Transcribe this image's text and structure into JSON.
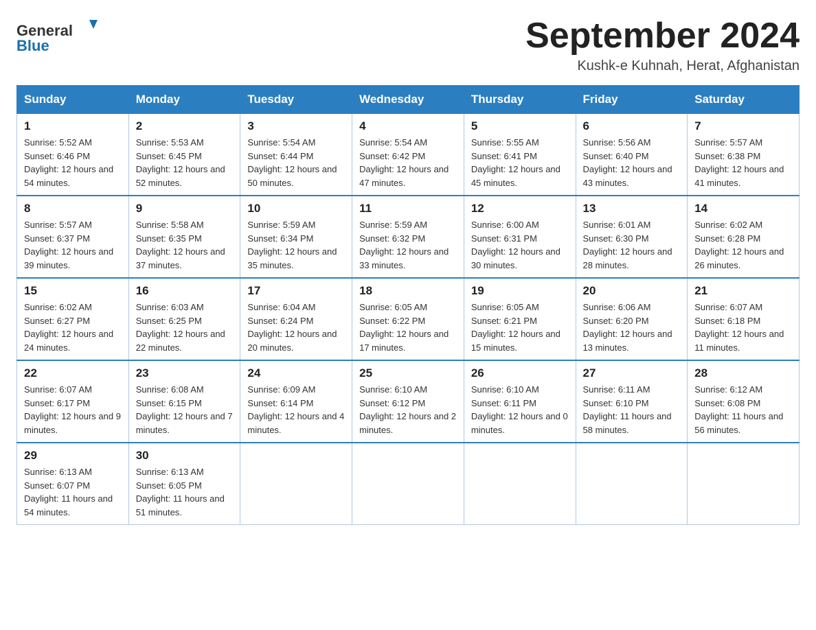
{
  "header": {
    "logo_general": "General",
    "logo_blue": "Blue",
    "title": "September 2024",
    "location": "Kushk-e Kuhnah, Herat, Afghanistan"
  },
  "days_of_week": [
    "Sunday",
    "Monday",
    "Tuesday",
    "Wednesday",
    "Thursday",
    "Friday",
    "Saturday"
  ],
  "weeks": [
    [
      {
        "day": "1",
        "sunrise": "Sunrise: 5:52 AM",
        "sunset": "Sunset: 6:46 PM",
        "daylight": "Daylight: 12 hours and 54 minutes."
      },
      {
        "day": "2",
        "sunrise": "Sunrise: 5:53 AM",
        "sunset": "Sunset: 6:45 PM",
        "daylight": "Daylight: 12 hours and 52 minutes."
      },
      {
        "day": "3",
        "sunrise": "Sunrise: 5:54 AM",
        "sunset": "Sunset: 6:44 PM",
        "daylight": "Daylight: 12 hours and 50 minutes."
      },
      {
        "day": "4",
        "sunrise": "Sunrise: 5:54 AM",
        "sunset": "Sunset: 6:42 PM",
        "daylight": "Daylight: 12 hours and 47 minutes."
      },
      {
        "day": "5",
        "sunrise": "Sunrise: 5:55 AM",
        "sunset": "Sunset: 6:41 PM",
        "daylight": "Daylight: 12 hours and 45 minutes."
      },
      {
        "day": "6",
        "sunrise": "Sunrise: 5:56 AM",
        "sunset": "Sunset: 6:40 PM",
        "daylight": "Daylight: 12 hours and 43 minutes."
      },
      {
        "day": "7",
        "sunrise": "Sunrise: 5:57 AM",
        "sunset": "Sunset: 6:38 PM",
        "daylight": "Daylight: 12 hours and 41 minutes."
      }
    ],
    [
      {
        "day": "8",
        "sunrise": "Sunrise: 5:57 AM",
        "sunset": "Sunset: 6:37 PM",
        "daylight": "Daylight: 12 hours and 39 minutes."
      },
      {
        "day": "9",
        "sunrise": "Sunrise: 5:58 AM",
        "sunset": "Sunset: 6:35 PM",
        "daylight": "Daylight: 12 hours and 37 minutes."
      },
      {
        "day": "10",
        "sunrise": "Sunrise: 5:59 AM",
        "sunset": "Sunset: 6:34 PM",
        "daylight": "Daylight: 12 hours and 35 minutes."
      },
      {
        "day": "11",
        "sunrise": "Sunrise: 5:59 AM",
        "sunset": "Sunset: 6:32 PM",
        "daylight": "Daylight: 12 hours and 33 minutes."
      },
      {
        "day": "12",
        "sunrise": "Sunrise: 6:00 AM",
        "sunset": "Sunset: 6:31 PM",
        "daylight": "Daylight: 12 hours and 30 minutes."
      },
      {
        "day": "13",
        "sunrise": "Sunrise: 6:01 AM",
        "sunset": "Sunset: 6:30 PM",
        "daylight": "Daylight: 12 hours and 28 minutes."
      },
      {
        "day": "14",
        "sunrise": "Sunrise: 6:02 AM",
        "sunset": "Sunset: 6:28 PM",
        "daylight": "Daylight: 12 hours and 26 minutes."
      }
    ],
    [
      {
        "day": "15",
        "sunrise": "Sunrise: 6:02 AM",
        "sunset": "Sunset: 6:27 PM",
        "daylight": "Daylight: 12 hours and 24 minutes."
      },
      {
        "day": "16",
        "sunrise": "Sunrise: 6:03 AM",
        "sunset": "Sunset: 6:25 PM",
        "daylight": "Daylight: 12 hours and 22 minutes."
      },
      {
        "day": "17",
        "sunrise": "Sunrise: 6:04 AM",
        "sunset": "Sunset: 6:24 PM",
        "daylight": "Daylight: 12 hours and 20 minutes."
      },
      {
        "day": "18",
        "sunrise": "Sunrise: 6:05 AM",
        "sunset": "Sunset: 6:22 PM",
        "daylight": "Daylight: 12 hours and 17 minutes."
      },
      {
        "day": "19",
        "sunrise": "Sunrise: 6:05 AM",
        "sunset": "Sunset: 6:21 PM",
        "daylight": "Daylight: 12 hours and 15 minutes."
      },
      {
        "day": "20",
        "sunrise": "Sunrise: 6:06 AM",
        "sunset": "Sunset: 6:20 PM",
        "daylight": "Daylight: 12 hours and 13 minutes."
      },
      {
        "day": "21",
        "sunrise": "Sunrise: 6:07 AM",
        "sunset": "Sunset: 6:18 PM",
        "daylight": "Daylight: 12 hours and 11 minutes."
      }
    ],
    [
      {
        "day": "22",
        "sunrise": "Sunrise: 6:07 AM",
        "sunset": "Sunset: 6:17 PM",
        "daylight": "Daylight: 12 hours and 9 minutes."
      },
      {
        "day": "23",
        "sunrise": "Sunrise: 6:08 AM",
        "sunset": "Sunset: 6:15 PM",
        "daylight": "Daylight: 12 hours and 7 minutes."
      },
      {
        "day": "24",
        "sunrise": "Sunrise: 6:09 AM",
        "sunset": "Sunset: 6:14 PM",
        "daylight": "Daylight: 12 hours and 4 minutes."
      },
      {
        "day": "25",
        "sunrise": "Sunrise: 6:10 AM",
        "sunset": "Sunset: 6:12 PM",
        "daylight": "Daylight: 12 hours and 2 minutes."
      },
      {
        "day": "26",
        "sunrise": "Sunrise: 6:10 AM",
        "sunset": "Sunset: 6:11 PM",
        "daylight": "Daylight: 12 hours and 0 minutes."
      },
      {
        "day": "27",
        "sunrise": "Sunrise: 6:11 AM",
        "sunset": "Sunset: 6:10 PM",
        "daylight": "Daylight: 11 hours and 58 minutes."
      },
      {
        "day": "28",
        "sunrise": "Sunrise: 6:12 AM",
        "sunset": "Sunset: 6:08 PM",
        "daylight": "Daylight: 11 hours and 56 minutes."
      }
    ],
    [
      {
        "day": "29",
        "sunrise": "Sunrise: 6:13 AM",
        "sunset": "Sunset: 6:07 PM",
        "daylight": "Daylight: 11 hours and 54 minutes."
      },
      {
        "day": "30",
        "sunrise": "Sunrise: 6:13 AM",
        "sunset": "Sunset: 6:05 PM",
        "daylight": "Daylight: 11 hours and 51 minutes."
      },
      null,
      null,
      null,
      null,
      null
    ]
  ]
}
